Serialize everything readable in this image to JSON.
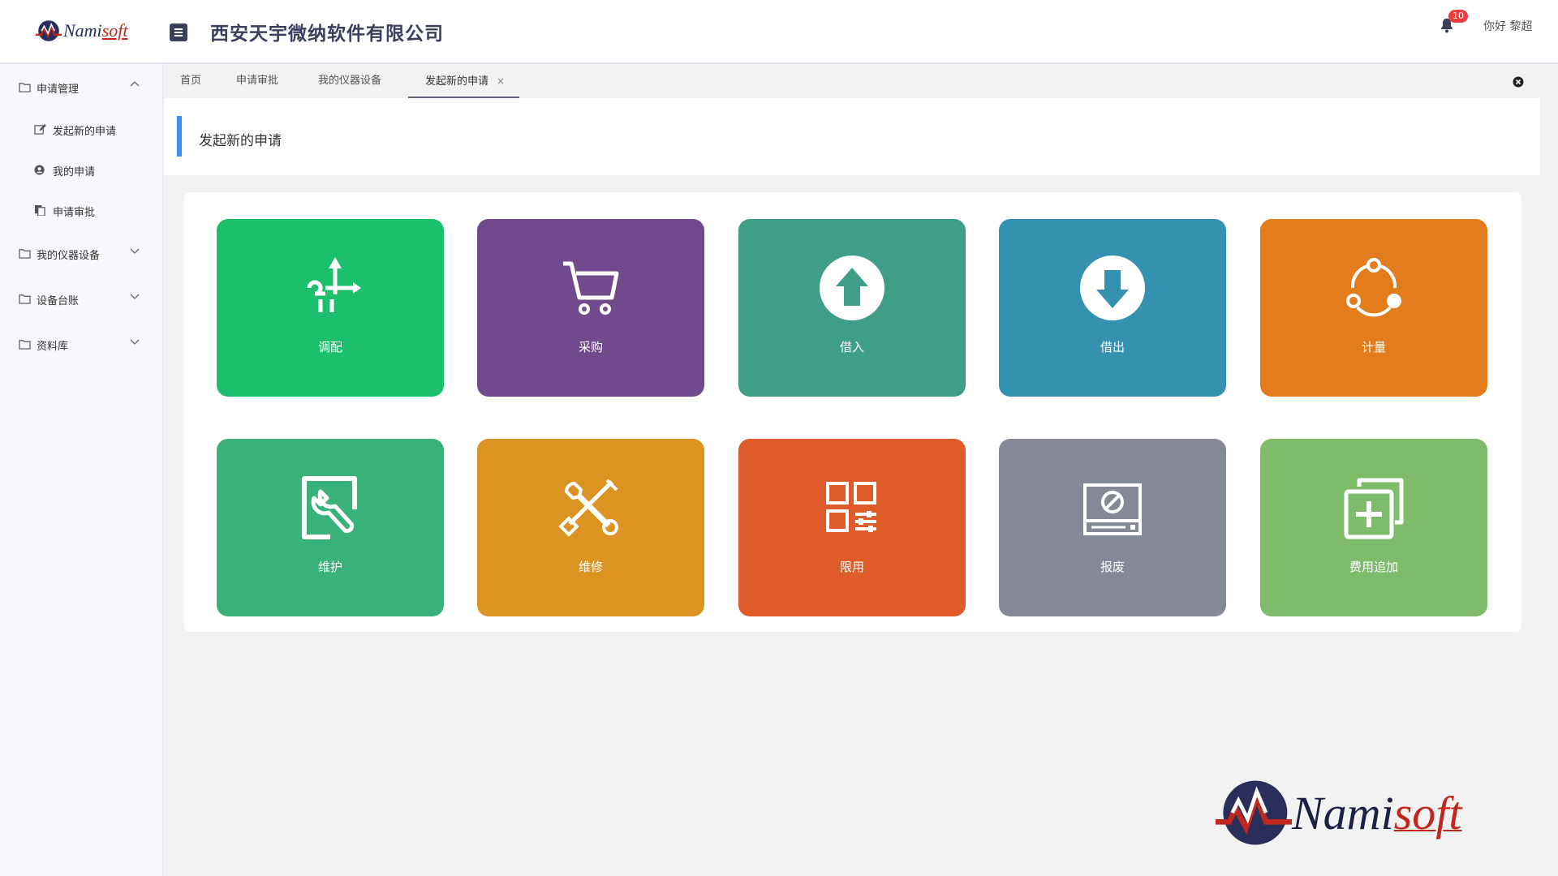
{
  "header": {
    "logo_name": "Nami",
    "logo_suffix": "soft",
    "company": "西安天宇微纳软件有限公司",
    "notifications_count": "10",
    "greeting": "你好 黎超"
  },
  "sidebar": {
    "items": [
      {
        "label": "申请管理",
        "expanded": true
      },
      {
        "label": "发起新的申请"
      },
      {
        "label": "我的申请"
      },
      {
        "label": "申请审批"
      },
      {
        "label": "我的仪器设备",
        "expanded": false
      },
      {
        "label": "设备台账",
        "expanded": false
      },
      {
        "label": "资料库",
        "expanded": false
      }
    ]
  },
  "tabs": [
    {
      "label": "首页"
    },
    {
      "label": "申请审批"
    },
    {
      "label": "我的仪器设备"
    },
    {
      "label": "发起新的申请",
      "active": true,
      "close": "×"
    }
  ],
  "page": {
    "title": "发起新的申请"
  },
  "tiles": [
    {
      "label": "调配",
      "color": "#1cc06c",
      "icon": "route-icon"
    },
    {
      "label": "采购",
      "color": "#704a8c",
      "icon": "cart-icon"
    },
    {
      "label": "借入",
      "color": "#3f9e8a",
      "icon": "upload-arrow-icon"
    },
    {
      "label": "借出",
      "color": "#3491af",
      "icon": "download-arrow-icon"
    },
    {
      "label": "计量",
      "color": "#e37c1d",
      "icon": "cycle-icon"
    },
    {
      "label": "维护",
      "color": "#39b17a",
      "icon": "wrench-search-icon"
    },
    {
      "label": "维修",
      "color": "#db9322",
      "icon": "tools-icon"
    },
    {
      "label": "限用",
      "color": "#e05b2a",
      "icon": "grid-settings-icon"
    },
    {
      "label": "报废",
      "color": "#848897",
      "icon": "scrap-icon"
    },
    {
      "label": "费用追加",
      "color": "#7ebc6b",
      "icon": "add-copy-icon"
    }
  ],
  "watermark": {
    "name": "Nami",
    "suffix": "soft"
  }
}
